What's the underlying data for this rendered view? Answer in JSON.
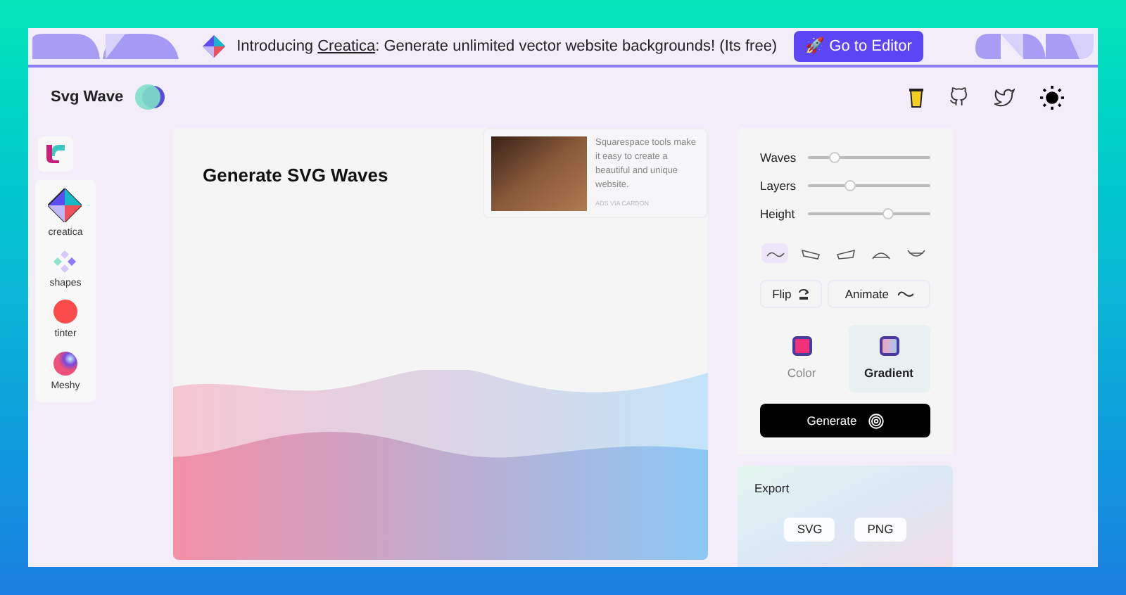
{
  "banner": {
    "text_before": "Introducing ",
    "link": "Creatica",
    "text_after": ": Generate unlimited vector website backgrounds! (Its free)",
    "button": "🚀 Go to Editor"
  },
  "header": {
    "title": "Svg Wave"
  },
  "sidebar": {
    "items": [
      {
        "label": "creatica",
        "kind": "cube"
      },
      {
        "label": "shapes",
        "kind": "diamonds"
      },
      {
        "label": "tinter",
        "kind": "dot"
      },
      {
        "label": "Meshy",
        "kind": "mesh"
      }
    ]
  },
  "canvas": {
    "heading": "Generate SVG Waves"
  },
  "ad": {
    "text": "Squarespace tools make it easy to create a beautiful and unique website.",
    "footer": "ADS VIA CARBON"
  },
  "controls": {
    "sliders": [
      {
        "label": "Waves",
        "level": 0.22
      },
      {
        "label": "Layers",
        "level": 0.35
      },
      {
        "label": "Height",
        "level": 0.65
      }
    ],
    "wave_styles": [
      {
        "kind": "wave",
        "selected": true
      },
      {
        "kind": "slant-left",
        "selected": false
      },
      {
        "kind": "slant-right",
        "selected": false
      },
      {
        "kind": "arch",
        "selected": false
      },
      {
        "kind": "bowl",
        "selected": false
      }
    ],
    "flip": "Flip",
    "animate": "Animate",
    "modes": [
      {
        "label": "Color",
        "kind": "solid",
        "selected": false
      },
      {
        "label": "Gradient",
        "kind": "gradient",
        "selected": true
      }
    ],
    "generate": "Generate"
  },
  "export": {
    "title": "Export",
    "buttons": [
      "SVG",
      "PNG"
    ]
  }
}
